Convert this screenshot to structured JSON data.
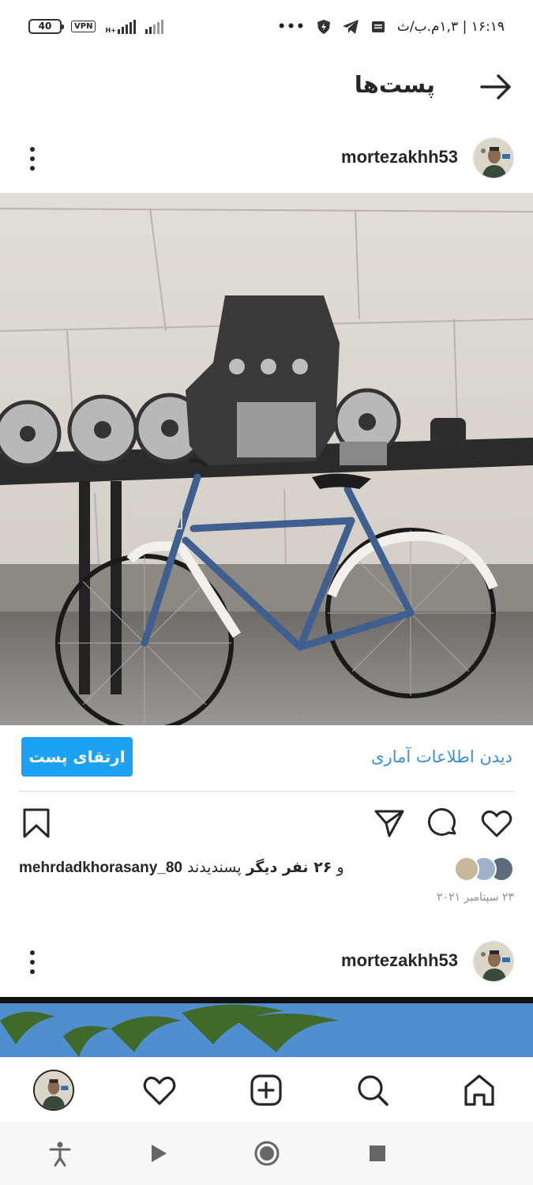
{
  "status_bar": {
    "time": "۱۶:۱۹ | ۱,۳م.ب/ث",
    "dots": "•••",
    "battery": "40",
    "vpn": "VPN",
    "network": "H+"
  },
  "header": {
    "title": "پست‌ها"
  },
  "post1": {
    "username": "mortezakhh53",
    "insights_label": "دیدن اطلاعات آماری",
    "boost_label": "ارتقای پست",
    "likes_prefix": "و",
    "likes_count": "۲۶ نفر دیگر",
    "likes_suffix": "پسندیدند",
    "liked_by": "mehrdadkhorasany_80",
    "date": "۲۳ سپتامبر ۲۰۲۱"
  },
  "post2": {
    "username": "mortezakhh53"
  },
  "icons": {
    "back": "arrow-right-icon",
    "more": "more-vertical-icon",
    "like": "heart-icon",
    "comment": "comment-icon",
    "share": "send-icon",
    "save": "bookmark-icon",
    "home": "home-icon",
    "search": "search-icon",
    "create": "plus-square-icon",
    "activity": "heart-icon",
    "profile": "avatar"
  },
  "colors": {
    "accent": "#1da1f2",
    "link": "#3b8fd6",
    "text": "#262626",
    "muted": "#8e8e8e"
  }
}
